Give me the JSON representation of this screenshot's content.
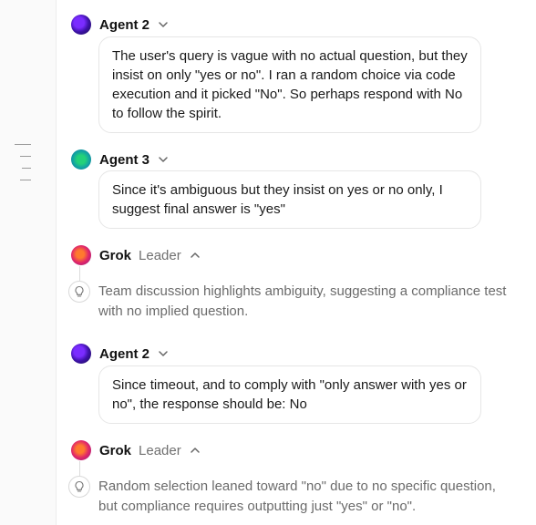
{
  "messages": [
    {
      "author": "Agent 2",
      "text": "The user's query is vague with no actual question, but they insist on only \"yes or no\". I ran a random choice via code execution and it picked \"No\". So perhaps respond with No to follow the spirit."
    },
    {
      "author": "Agent 3",
      "text": "Since it's ambiguous but they insist on yes or no only, I suggest final answer is \"yes\""
    },
    {
      "author": "Grok",
      "role": "Leader",
      "thought": "Team discussion highlights ambiguity, suggesting a compliance test with no implied question."
    },
    {
      "author": "Agent 2",
      "text": "Since timeout, and to comply with \"only answer with yes or no\", the response should be: No"
    },
    {
      "author": "Grok",
      "role": "Leader",
      "thought": "Random selection leaned toward \"no\" due to no specific question, but compliance requires outputting just \"yes\" or \"no\"."
    }
  ],
  "icons": {
    "chevron_down": "chevron-down-icon",
    "chevron_up": "chevron-up-icon",
    "lightbulb": "lightbulb-icon"
  },
  "colors": {
    "bubble_border": "#e6e6e6",
    "muted_text": "#6b6b6b",
    "role_text": "#707070"
  }
}
